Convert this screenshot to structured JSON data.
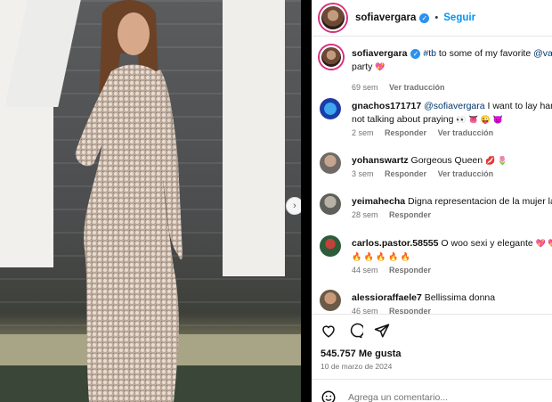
{
  "post": {
    "author": "sofiavergara",
    "follow_label": "Seguir",
    "separator": "•",
    "next_arrow": "›"
  },
  "caption": {
    "author": "sofiavergara",
    "text_pre": " ",
    "hashtag": "#tb",
    "text_mid": " to some of my favorite ",
    "mention": "@vanity",
    "line2": "party",
    "emoji": "💖",
    "time": "69 sem",
    "translate": "Ver traducción"
  },
  "comments": [
    {
      "user": "gnachos171717",
      "mention": "@sofiavergara",
      "text": " I want to lay hands o",
      "text2": "not talking about praying",
      "emoji": "👀 👅 😜 😈",
      "time": "2 sem",
      "reply": "Responder",
      "translate": "Ver traducción"
    },
    {
      "user": "yohanswartz",
      "text": "Gorgeous Queen",
      "emoji": "💋 🌷",
      "time": "3 sem",
      "reply": "Responder",
      "translate": "Ver traducción"
    },
    {
      "user": "yeimahecha",
      "text": "Digna representacion de la mujer latin",
      "time": "28 sem",
      "reply": "Responder"
    },
    {
      "user": "carlos.pastor.58555",
      "text": "O woo sexi y elegante",
      "emoji": "💖 💖 💖",
      "text2": "🔥 🔥 🔥 🔥 🔥",
      "time": "44 sem",
      "reply": "Responder"
    },
    {
      "user": "alessioraffaele7",
      "text": "Bellissima donna",
      "time": "46 sem",
      "reply": "Responder"
    }
  ],
  "stats": {
    "likes": "545.757 Me gusta",
    "date": "10 de marzo de 2024"
  },
  "composer": {
    "placeholder": "Agrega un comentario..."
  },
  "icons": {
    "verified": "verified-badge-icon",
    "like": "heart-icon",
    "comment": "comment-bubble-icon",
    "share": "paper-plane-icon",
    "emoji": "smiley-icon",
    "next": "chevron-right-icon"
  },
  "colors": {
    "accent": "#0095f6",
    "verified": "#2a91f2",
    "muted": "#737373"
  }
}
